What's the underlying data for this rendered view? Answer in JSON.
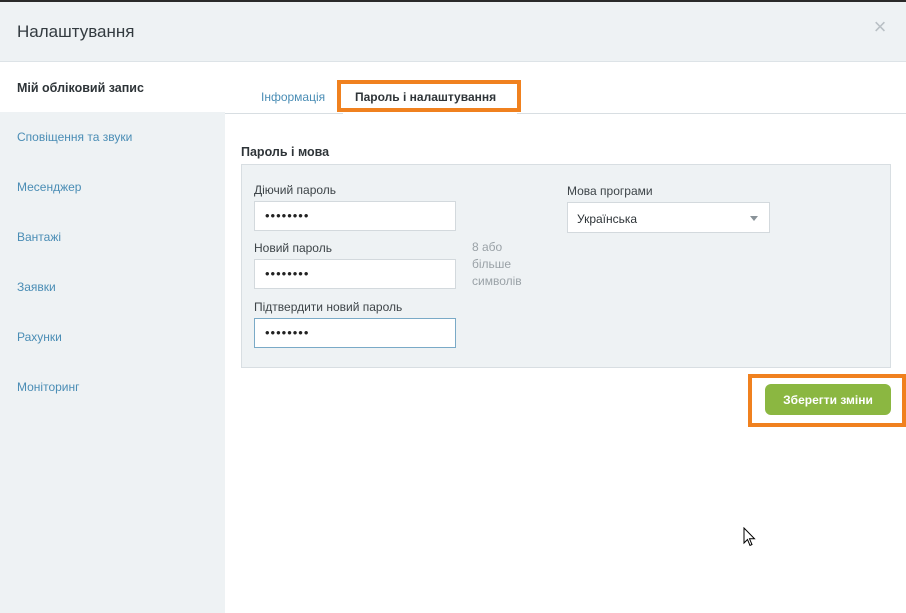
{
  "header": {
    "title": "Налаштування",
    "close_icon": "close-icon"
  },
  "sidebar": {
    "items": [
      {
        "label": "Мій обліковий запис",
        "active": true
      },
      {
        "label": "Сповіщення та звуки",
        "active": false
      },
      {
        "label": "Месенджер",
        "active": false
      },
      {
        "label": "Вантажі",
        "active": false
      },
      {
        "label": "Заявки",
        "active": false
      },
      {
        "label": "Рахунки",
        "active": false
      },
      {
        "label": "Моніторинг",
        "active": false
      }
    ]
  },
  "tabs": [
    {
      "label": "Інформація",
      "active": false
    },
    {
      "label": "Пароль і налаштування",
      "active": true
    }
  ],
  "section": {
    "title": "Пароль і мова",
    "current_password": {
      "label": "Діючий пароль",
      "value": "••••••••"
    },
    "new_password": {
      "label": "Новий пароль",
      "value": "••••••••"
    },
    "confirm_password": {
      "label": "Підтвердити новий пароль",
      "value": "••••••••"
    },
    "hint": "8 або більше символів",
    "language": {
      "label": "Мова програми",
      "value": "Українська"
    }
  },
  "actions": {
    "save_label": "Зберегти зміни"
  },
  "colors": {
    "highlight": "#f0811f",
    "save_button": "#8bb741",
    "link": "#4a8db5",
    "panel_bg": "#eef2f4"
  }
}
